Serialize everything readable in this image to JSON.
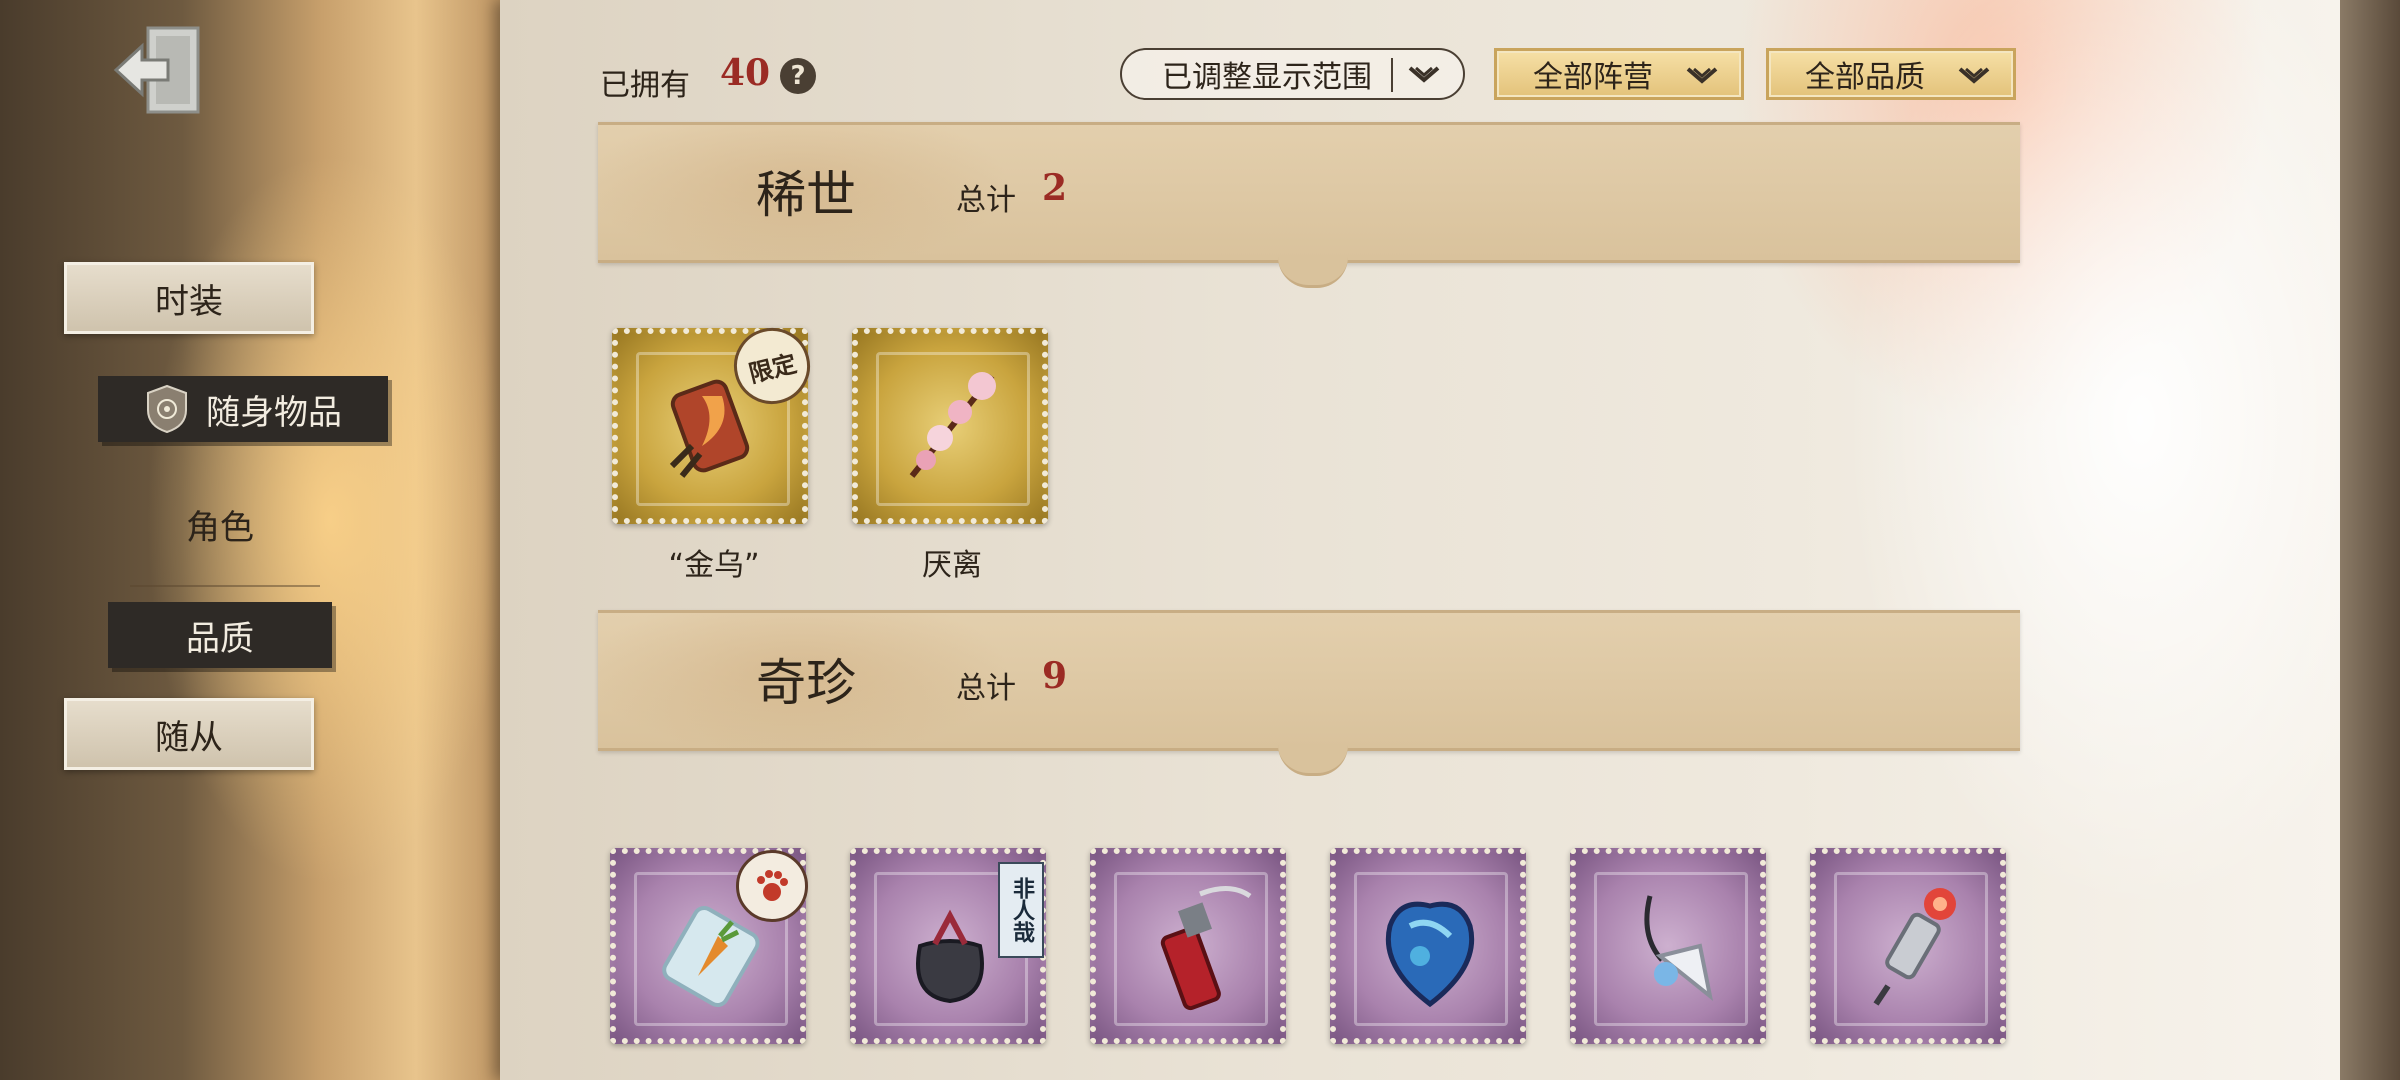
{
  "sidebar": {
    "items": [
      {
        "label": "时装"
      },
      {
        "label": "随身物品"
      },
      {
        "label": "角色"
      },
      {
        "label": "品质"
      },
      {
        "label": "随从"
      }
    ]
  },
  "header": {
    "owned_label": "已拥有",
    "owned_count": "40",
    "help_icon": "?",
    "filters": [
      {
        "label": "已调整显示范围"
      },
      {
        "label": "全部阵营"
      },
      {
        "label": "全部品质"
      }
    ]
  },
  "sections": [
    {
      "title": "稀世",
      "total_label": "总计",
      "total": "2",
      "items": [
        {
          "name": "“金乌”",
          "badge": "限定",
          "icon": "flame-lantern-icon"
        },
        {
          "name": "厌离",
          "icon": "cherry-blossom-branch-icon"
        }
      ]
    },
    {
      "title": "奇珍",
      "total_label": "总计",
      "total": "9",
      "items": [
        {
          "icon": "carrot-jar-icon",
          "badge_icon": "paw-icon"
        },
        {
          "icon": "pouch-icon",
          "badge": "非人哉"
        },
        {
          "icon": "red-lighter-icon"
        },
        {
          "icon": "blue-heart-gem-icon"
        },
        {
          "icon": "pendant-icon"
        },
        {
          "icon": "spark-plug-icon"
        }
      ]
    }
  ],
  "colors": {
    "accent_red": "#9b2b24",
    "gold_stamp": "#c9a43e",
    "purple_stamp": "#a982ad",
    "banner": "#d9c29c"
  }
}
